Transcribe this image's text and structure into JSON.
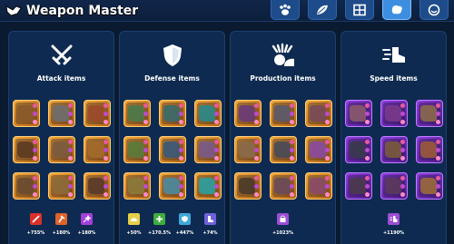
{
  "header": {
    "title": "Weapon Master",
    "tabs": [
      {
        "icon": "paw-icon",
        "active": false
      },
      {
        "icon": "leaf-icon",
        "active": false
      },
      {
        "icon": "blueprint-icon",
        "active": false
      },
      {
        "icon": "brain-icon",
        "active": true
      },
      {
        "icon": "face-icon",
        "active": false
      }
    ]
  },
  "panels": [
    {
      "title": "Attack items",
      "icon": "crossed-swords-icon",
      "rarity": "orange",
      "stats": [
        {
          "value": "+755%",
          "icon": "sword-icon",
          "color": "#d8312b"
        },
        {
          "value": "+180%",
          "icon": "axe-icon",
          "color": "#e0622b"
        },
        {
          "value": "+180%",
          "icon": "magic-icon",
          "color": "#a23fd9"
        }
      ]
    },
    {
      "title": "Defense items",
      "icon": "shield-icon",
      "rarity": "orange",
      "stats": [
        {
          "value": "+50%",
          "icon": "helmet-icon",
          "color": "#e6d04a"
        },
        {
          "value": "+170.5%",
          "icon": "heal-icon",
          "color": "#3fae3f"
        },
        {
          "value": "+447%",
          "icon": "armor-icon",
          "color": "#3fa7d9"
        },
        {
          "value": "+74%",
          "icon": "boot-icon",
          "color": "#6f62d9"
        }
      ]
    },
    {
      "title": "Production items",
      "icon": "production-icon",
      "rarity": "orange",
      "stats": [
        {
          "value": "+1023%",
          "icon": "production-icon",
          "color": "#9c4cd6"
        }
      ]
    },
    {
      "title": "Speed items",
      "icon": "speed-boot-icon",
      "rarity": "purple",
      "stats": [
        {
          "value": "+1190%",
          "icon": "speed-boot-icon",
          "color": "#9c4cd6"
        }
      ]
    }
  ],
  "colors": {
    "background": "#0a1a30",
    "panel": "#0e2a50",
    "rarity_orange": "#f3a73a",
    "rarity_purple": "#8f3ee0",
    "tab_active": "#3d8ee0"
  }
}
